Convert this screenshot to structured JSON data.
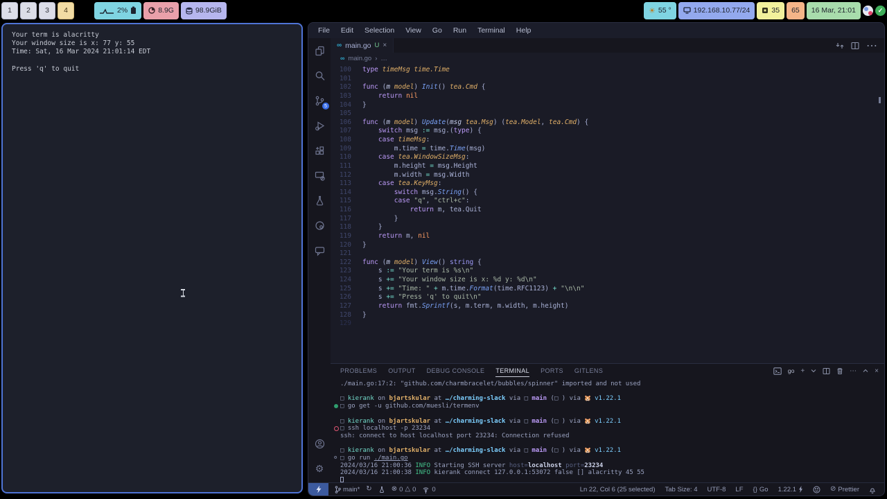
{
  "topbar": {
    "workspaces": [
      {
        "label": "1",
        "active": false
      },
      {
        "label": "2",
        "active": false
      },
      {
        "label": "3",
        "active": false
      },
      {
        "label": "4",
        "active": true
      }
    ],
    "cpu_value": "2%",
    "memory_value": "8.9G",
    "disk_value": "98.9GiB",
    "temperature_value": "55 °",
    "network_value": "192.168.10.77/24",
    "badge35_value": "35",
    "badge65_value": "65",
    "datetime_value": "16 Mar, 21:01"
  },
  "alacritty": {
    "lines": [
      "Your term is alacritty",
      "Your window size is x: 77 y: 55",
      "Time: Sat, 16 Mar 2024 21:01:14 EDT",
      "",
      "Press 'q' to quit"
    ]
  },
  "vscode": {
    "menu": [
      "File",
      "Edit",
      "Selection",
      "View",
      "Go",
      "Run",
      "Terminal",
      "Help"
    ],
    "tab": {
      "icon": "∞",
      "label": "main.go",
      "git_status": "U",
      "close": "×"
    },
    "breadcrumb": {
      "icon": "∞",
      "file": "main.go",
      "separator": "›",
      "more": "…"
    },
    "scm_badge": "5",
    "editor": {
      "lines": [
        {
          "n": "100",
          "t": [
            [
              "kw",
              "type"
            ],
            [
              "df",
              " "
            ],
            [
              "ty",
              "timeMsg"
            ],
            [
              "df",
              " "
            ],
            [
              "ty",
              "time.Time"
            ]
          ]
        },
        {
          "n": "101",
          "t": []
        },
        {
          "n": "102",
          "t": [
            [
              "kw",
              "func"
            ],
            [
              "df",
              " ("
            ],
            [
              "pi",
              "m"
            ],
            [
              "df",
              " "
            ],
            [
              "ty",
              "model"
            ],
            [
              "df",
              ") "
            ],
            [
              "fn",
              "Init"
            ],
            [
              "df",
              "() "
            ],
            [
              "ty",
              "tea.Cmd"
            ],
            [
              "df",
              " {"
            ]
          ]
        },
        {
          "n": "103",
          "t": [
            [
              "df",
              "    "
            ],
            [
              "kw",
              "return"
            ],
            [
              "df",
              " "
            ],
            [
              "nu",
              "nil"
            ]
          ]
        },
        {
          "n": "104",
          "t": [
            [
              "df",
              "}"
            ]
          ]
        },
        {
          "n": "105",
          "t": []
        },
        {
          "n": "106",
          "t": [
            [
              "kw",
              "func"
            ],
            [
              "df",
              " ("
            ],
            [
              "pi",
              "m"
            ],
            [
              "df",
              " "
            ],
            [
              "ty",
              "model"
            ],
            [
              "df",
              ") "
            ],
            [
              "fn",
              "Update"
            ],
            [
              "df",
              "("
            ],
            [
              "pi",
              "msg"
            ],
            [
              "df",
              " "
            ],
            [
              "ty",
              "tea.Msg"
            ],
            [
              "df",
              ") ("
            ],
            [
              "ty",
              "tea.Model"
            ],
            [
              "df",
              ", "
            ],
            [
              "ty",
              "tea.Cmd"
            ],
            [
              "df",
              ") {"
            ]
          ]
        },
        {
          "n": "107",
          "t": [
            [
              "df",
              "    "
            ],
            [
              "kw",
              "switch"
            ],
            [
              "df",
              " msg "
            ],
            [
              "op",
              ":="
            ],
            [
              "df",
              " msg.("
            ],
            [
              "kw",
              "type"
            ],
            [
              "df",
              ") {"
            ]
          ]
        },
        {
          "n": "108",
          "t": [
            [
              "df",
              "    "
            ],
            [
              "kw",
              "case"
            ],
            [
              "df",
              " "
            ],
            [
              "ty",
              "timeMsg"
            ],
            [
              "df",
              ":"
            ]
          ]
        },
        {
          "n": "109",
          "t": [
            [
              "df",
              "        m.time "
            ],
            [
              "op",
              "="
            ],
            [
              "df",
              " time."
            ],
            [
              "fn",
              "Time"
            ],
            [
              "df",
              "(msg)"
            ]
          ]
        },
        {
          "n": "110",
          "t": [
            [
              "df",
              "    "
            ],
            [
              "kw",
              "case"
            ],
            [
              "df",
              " "
            ],
            [
              "ty",
              "tea.WindowSizeMsg"
            ],
            [
              "df",
              ":"
            ]
          ]
        },
        {
          "n": "111",
          "t": [
            [
              "df",
              "        m.height "
            ],
            [
              "op",
              "="
            ],
            [
              "df",
              " msg.Height"
            ]
          ]
        },
        {
          "n": "112",
          "t": [
            [
              "df",
              "        m.width "
            ],
            [
              "op",
              "="
            ],
            [
              "df",
              " msg.Width"
            ]
          ]
        },
        {
          "n": "113",
          "t": [
            [
              "df",
              "    "
            ],
            [
              "kw",
              "case"
            ],
            [
              "df",
              " "
            ],
            [
              "ty",
              "tea.KeyMsg"
            ],
            [
              "df",
              ":"
            ]
          ]
        },
        {
          "n": "114",
          "t": [
            [
              "df",
              "        "
            ],
            [
              "kw",
              "switch"
            ],
            [
              "df",
              " msg."
            ],
            [
              "fn",
              "String"
            ],
            [
              "df",
              "() {"
            ]
          ]
        },
        {
          "n": "115",
          "t": [
            [
              "df",
              "        "
            ],
            [
              "kw",
              "case"
            ],
            [
              "df",
              " "
            ],
            [
              "st",
              "\"q\""
            ],
            [
              "df",
              ", "
            ],
            [
              "st",
              "\"ctrl+c\""
            ],
            [
              "df",
              ":"
            ]
          ]
        },
        {
          "n": "116",
          "t": [
            [
              "df",
              "            "
            ],
            [
              "kw",
              "return"
            ],
            [
              "df",
              " m, tea.Quit"
            ]
          ]
        },
        {
          "n": "117",
          "t": [
            [
              "df",
              "        }"
            ]
          ]
        },
        {
          "n": "118",
          "t": [
            [
              "df",
              "    }"
            ]
          ]
        },
        {
          "n": "119",
          "t": [
            [
              "df",
              "    "
            ],
            [
              "kw",
              "return"
            ],
            [
              "df",
              " m, "
            ],
            [
              "nu",
              "nil"
            ]
          ]
        },
        {
          "n": "120",
          "t": [
            [
              "df",
              "}"
            ]
          ]
        },
        {
          "n": "121",
          "t": []
        },
        {
          "n": "122",
          "t": [
            [
              "kw",
              "func"
            ],
            [
              "df",
              " ("
            ],
            [
              "pi",
              "m"
            ],
            [
              "df",
              " "
            ],
            [
              "ty",
              "model"
            ],
            [
              "df",
              ") "
            ],
            [
              "fn",
              "View"
            ],
            [
              "df",
              "() "
            ],
            [
              "k2",
              "string"
            ],
            [
              "df",
              " {"
            ]
          ]
        },
        {
          "n": "123",
          "t": [
            [
              "df",
              "    s "
            ],
            [
              "op",
              ":="
            ],
            [
              "df",
              " "
            ],
            [
              "st",
              "\"Your term is %s\\n\""
            ]
          ]
        },
        {
          "n": "124",
          "t": [
            [
              "df",
              "    s "
            ],
            [
              "op",
              "+="
            ],
            [
              "df",
              " "
            ],
            [
              "st",
              "\"Your window size is x: %d y: %d\\n\""
            ]
          ]
        },
        {
          "n": "125",
          "t": [
            [
              "df",
              "    s "
            ],
            [
              "op",
              "+="
            ],
            [
              "df",
              " "
            ],
            [
              "st",
              "\"Time: \""
            ],
            [
              "df",
              " "
            ],
            [
              "op",
              "+"
            ],
            [
              "df",
              " m.time."
            ],
            [
              "fn",
              "Format"
            ],
            [
              "df",
              "(time.RFC1123) "
            ],
            [
              "op",
              "+"
            ],
            [
              "df",
              " "
            ],
            [
              "st",
              "\"\\n\\n\""
            ]
          ]
        },
        {
          "n": "126",
          "t": [
            [
              "df",
              "    s "
            ],
            [
              "op",
              "+="
            ],
            [
              "df",
              " "
            ],
            [
              "st",
              "\"Press 'q' to quit\\n\""
            ]
          ]
        },
        {
          "n": "127",
          "t": [
            [
              "df",
              "    "
            ],
            [
              "kw",
              "return"
            ],
            [
              "df",
              " fmt."
            ],
            [
              "fn",
              "Sprintf"
            ],
            [
              "df",
              "(s, m.term, m.width, m.height)"
            ]
          ]
        },
        {
          "n": "128",
          "t": [
            [
              "df",
              "}"
            ]
          ]
        },
        {
          "n": "129",
          "dim": true,
          "t": []
        }
      ]
    },
    "panel": {
      "tabs": [
        "PROBLEMS",
        "OUTPUT",
        "DEBUG CONSOLE",
        "TERMINAL",
        "PORTS",
        "GITLENS"
      ],
      "active_tab": "TERMINAL",
      "profile_label": "go",
      "lines": [
        {
          "seg": [
            [
              "df",
              "./main.go:17:2: \"github.com/charmbracelet/bubbles/spinner\" imported and not used"
            ]
          ]
        },
        {
          "seg": []
        },
        {
          "seg": [
            [
              "bx",
              "□ "
            ],
            [
              "us",
              "kierank"
            ],
            [
              "df",
              " on "
            ],
            [
              "ho",
              "bjartskular"
            ],
            [
              "df",
              " at "
            ],
            [
              "pa",
              "…/charming-slack"
            ],
            [
              "df",
              " via "
            ],
            [
              "bx",
              "□ "
            ],
            [
              "br",
              "main"
            ],
            [
              "df",
              " ("
            ],
            [
              "bx",
              "□"
            ],
            [
              "df",
              " ) via "
            ],
            [
              "em",
              "🐹 "
            ],
            [
              "vr",
              "v1.22.1"
            ]
          ]
        },
        {
          "dec": "ok",
          "seg": [
            [
              "bx",
              "□ "
            ],
            [
              "df",
              "go get -u github.com/muesli/termenv"
            ]
          ]
        },
        {
          "seg": []
        },
        {
          "seg": [
            [
              "bx",
              "□ "
            ],
            [
              "us",
              "kierank"
            ],
            [
              "df",
              " on "
            ],
            [
              "ho",
              "bjartskular"
            ],
            [
              "df",
              " at "
            ],
            [
              "pa",
              "…/charming-slack"
            ],
            [
              "df",
              " via "
            ],
            [
              "bx",
              "□ "
            ],
            [
              "br",
              "main"
            ],
            [
              "df",
              " ("
            ],
            [
              "bx",
              "□"
            ],
            [
              "df",
              " ) via "
            ],
            [
              "em",
              "🐹 "
            ],
            [
              "vr",
              "v1.22.1"
            ]
          ]
        },
        {
          "dec": "err",
          "seg": [
            [
              "bx",
              "□ "
            ],
            [
              "df",
              "ssh localhost -p 23234"
            ]
          ]
        },
        {
          "seg": [
            [
              "df",
              "ssh: connect to host localhost port 23234: Connection refused"
            ]
          ]
        },
        {
          "seg": []
        },
        {
          "seg": [
            [
              "bx",
              "□ "
            ],
            [
              "us",
              "kierank"
            ],
            [
              "df",
              " on "
            ],
            [
              "ho",
              "bjartskular"
            ],
            [
              "df",
              " at "
            ],
            [
              "pa",
              "…/charming-slack"
            ],
            [
              "df",
              " via "
            ],
            [
              "bx",
              "□ "
            ],
            [
              "br",
              "main"
            ],
            [
              "df",
              " ("
            ],
            [
              "bx",
              "□"
            ],
            [
              "df",
              " ) via "
            ],
            [
              "em",
              "🐹 "
            ],
            [
              "vr",
              "v1.22.1"
            ]
          ]
        },
        {
          "dec": "run",
          "seg": [
            [
              "bx",
              "□ "
            ],
            [
              "df",
              "go run "
            ],
            [
              "lk",
              "./main.go"
            ]
          ]
        },
        {
          "seg": [
            [
              "df",
              "2024/03/16 21:00:36 "
            ],
            [
              "in",
              "INFO"
            ],
            [
              "df",
              " Starting SSH server "
            ],
            [
              "dm",
              "host="
            ],
            [
              "bd",
              "localhost"
            ],
            [
              "dm",
              " port="
            ],
            [
              "bd",
              "23234"
            ]
          ]
        },
        {
          "seg": [
            [
              "df",
              "2024/03/16 21:00:38 "
            ],
            [
              "in",
              "INFO"
            ],
            [
              "df",
              " kierank connect 127.0.0.1:53072 false [] alacritty 45 55"
            ]
          ]
        },
        {
          "seg": [
            [
              "cu",
              ""
            ]
          ]
        }
      ]
    },
    "statusbar": {
      "branch": "main*",
      "errors": "0",
      "warnings": "0",
      "ports": "0",
      "line_col": "Ln 22, Col 6 (25 selected)",
      "tab_size": "Tab Size: 4",
      "encoding": "UTF-8",
      "eol": "LF",
      "lang_icon": "{}",
      "language": "Go",
      "go_version": "1.22.1",
      "formatter": "Prettier"
    }
  },
  "colors": {
    "window_accent_blue": "#4f74d6",
    "badge_cyan": "#7fd4e2",
    "badge_red": "#e9a0aa",
    "badge_purple": "#b6b6ee",
    "badge_blue": "#93a9ee",
    "badge_yellow": "#f1f09c",
    "badge_orange": "#f4b488",
    "badge_green": "#a8dcac",
    "syntax_keyword": "#bb9af7",
    "syntax_type": "#e0af68",
    "syntax_function": "#7aa2f7",
    "syntax_operator": "#73daca",
    "syntax_nil": "#ff9e64",
    "info_green": "#44c58c"
  }
}
